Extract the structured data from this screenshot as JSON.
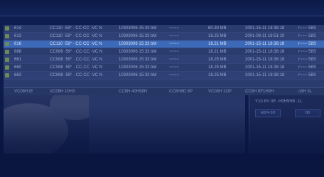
{
  "table": {
    "rows": [
      {
        "id": "614",
        "a": "CC110 ·59° · CC·CC ·VC N",
        "b": "10303006 15:33 bM",
        "c": "~~~~",
        "d": "60.30 MB",
        "e": "2001-15-11 18:38:18",
        "f": "r~~~ 58S"
      },
      {
        "id": "613",
        "a": "CC110 ·59° · CC·CC ·VC N",
        "b": "10303006 15:33 bM",
        "c": "~~~~",
        "d": "18.25 MB",
        "e": "2001-08-11 18:51:10",
        "f": "r~~~ 58S"
      },
      {
        "id": "616",
        "a": "CC110 ·59° · CC·CC ·VC N",
        "b": "10303006 15:33 bM",
        "c": "~~~~",
        "d": "18.21 MB",
        "e": "2001-15-11 18:38:18",
        "f": "r~~~ 58S"
      },
      {
        "id": "668",
        "a": "CC088 ·59° · CC·CC ·VC N",
        "b": "10303006 15:33 bM",
        "c": "~~~~",
        "d": "18.21 MB",
        "e": "2001-15-11 18:38:18",
        "f": "r~~~ 58S"
      },
      {
        "id": "661",
        "a": "CC088 ·59° · CC·CC ·VC N",
        "b": "10303006 15:33 bM",
        "c": "~~~~",
        "d": "18.25 MB",
        "e": "2001-15-11 18:38:18",
        "f": "r~~~ 58S"
      },
      {
        "id": "660",
        "a": "CC088 ·59° · CC·CC ·VC N",
        "b": "10303006 15:33 bM",
        "c": "~~~~",
        "d": "18.25 MB",
        "e": "2001-15-11 18:38:18",
        "f": "r~~~ 58S"
      },
      {
        "id": "663",
        "a": "CC088 ·59° · CC·CC ·VC N",
        "b": "10303006 15:33 bM",
        "c": "~~~~",
        "d": "18.25 MB",
        "e": "2001-15-11 18:38:18",
        "f": "r~~~ 58S"
      }
    ],
    "header": {
      "h1": "VC08H.IE",
      "h2": "VC08H 10H3",
      "h3": "CC8H 40H98H",
      "h4": "CC8H8D 8P",
      "h5": "VC08H 1OP",
      "h6": "CC8H 8F1H9H",
      "h7": "c8H 3L"
    }
  },
  "panel": {
    "title": "Y10·8Y·0E ·H0H9H8 ·1L",
    "btn1": "A8H4 8H",
    "btn2": "B8"
  },
  "colors": {
    "selected": "#3c69b8",
    "background": "#0b1a45"
  }
}
